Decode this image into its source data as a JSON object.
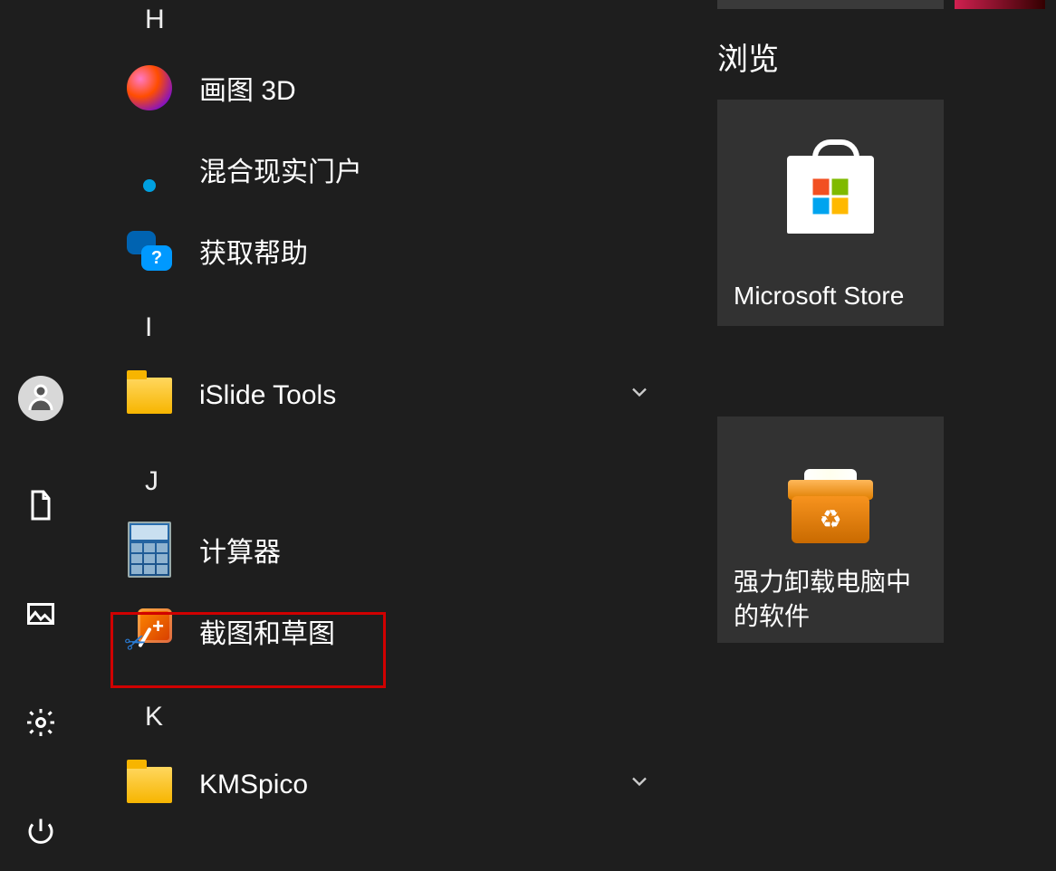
{
  "sections": {
    "H": "H",
    "I": "I",
    "J": "J",
    "K": "K"
  },
  "apps": {
    "paint3d": {
      "label": "画图 3D"
    },
    "mr": {
      "label": "混合现实门户"
    },
    "gethelp": {
      "label": "获取帮助"
    },
    "islide": {
      "label": "iSlide Tools"
    },
    "calc": {
      "label": "计算器"
    },
    "snip": {
      "label": "截图和草图"
    },
    "kmspico": {
      "label": "KMSpico"
    }
  },
  "tiles": {
    "group_title": "浏览",
    "store_label": "Microsoft Store",
    "uninstall_label": "强力卸载电脑中的软件"
  }
}
